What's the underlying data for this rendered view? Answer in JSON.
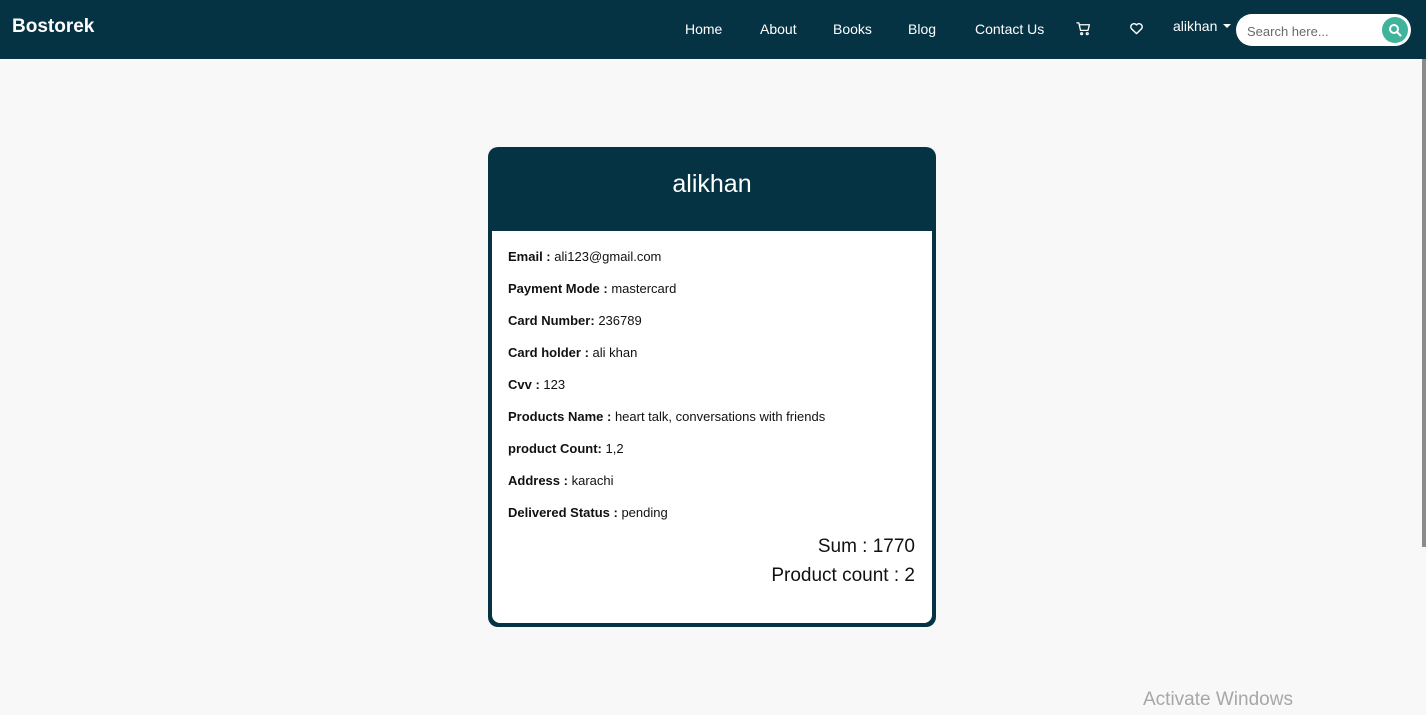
{
  "navbar": {
    "brand": "Bostorek",
    "links": [
      "Home",
      "About",
      "Books",
      "Blog",
      "Contact Us"
    ],
    "cart_icon": "cart-icon",
    "wishlist_icon": "heart-icon",
    "user": "alikhan",
    "search_placeholder": "Search here...",
    "search_icon": "search-icon"
  },
  "card": {
    "title": "alikhan",
    "fields": [
      {
        "label": "Email :",
        "value": "ali123@gmail.com"
      },
      {
        "label": "Payment Mode :",
        "value": "mastercard"
      },
      {
        "label": "Card Number:",
        "value": "236789"
      },
      {
        "label": "Card holder :",
        "value": "ali khan"
      },
      {
        "label": "Cvv :",
        "value": "123"
      },
      {
        "label": "Products Name :",
        "value": "heart talk, conversations with friends"
      },
      {
        "label": "product Count:",
        "value": "1,2"
      },
      {
        "label": "Address :",
        "value": "karachi"
      },
      {
        "label": "Delivered Status :",
        "value": "pending"
      }
    ],
    "sum": "Sum : 1770",
    "product_count": "Product count : 2"
  },
  "watermark": "Activate Windows",
  "colors": {
    "navbar": "#063344",
    "accent": "#3fb39c",
    "background": "#f8f8f8"
  }
}
